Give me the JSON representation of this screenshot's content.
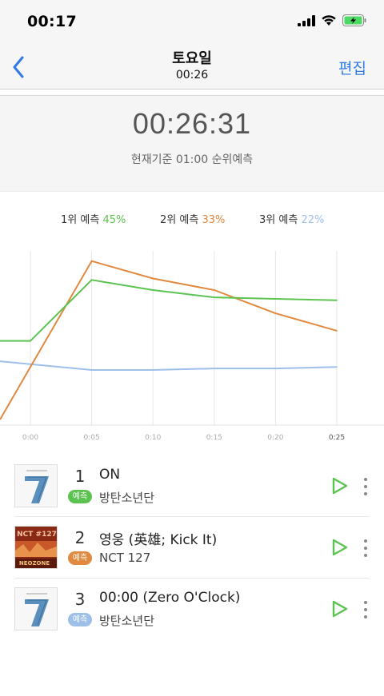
{
  "status": {
    "time": "00:17"
  },
  "nav": {
    "title": "토요일",
    "subtitle": "00:26",
    "edit_label": "편집"
  },
  "timer": {
    "current": "00:26:31",
    "basis": "현재기준 01:00 순위예측"
  },
  "legend": [
    {
      "label": "1위 예측",
      "percent": "45%",
      "color": "#5cc350"
    },
    {
      "label": "2위 예측",
      "percent": "33%",
      "color": "#e0893f"
    },
    {
      "label": "3위 예측",
      "percent": "22%",
      "color": "#9dbfe8"
    }
  ],
  "colors": {
    "accent": "#2f7ae5",
    "green": "#5cc350",
    "orange": "#e0893f",
    "blue": "#9dbfe8"
  },
  "chart_data": {
    "type": "line",
    "x": [
      "0:00",
      "0:05",
      "0:10",
      "0:15",
      "0:20",
      "0:25"
    ],
    "series": [
      {
        "name": "1위 예측",
        "color": "#5cc350",
        "values": [
          58,
          100,
          93,
          88,
          87,
          86
        ]
      },
      {
        "name": "2위 예측",
        "color": "#e0893f",
        "values": [
          40,
          113,
          101,
          93,
          77,
          65
        ]
      },
      {
        "name": "3위 예측",
        "color": "#9dbfe8",
        "values": [
          42,
          38,
          38,
          39,
          39,
          40
        ]
      }
    ],
    "grid": true
  },
  "songs": [
    {
      "rank": "1",
      "title": "ON",
      "badge": "예측",
      "badge_color": "#5cc350",
      "artist": "방탄소년단",
      "album_icon": "album-7-cover"
    },
    {
      "rank": "2",
      "title": "영웅 (英雄; Kick It)",
      "badge": "예측",
      "badge_color": "#e0893f",
      "artist": "NCT 127",
      "album_icon": "album-nct127-cover",
      "album_text": "NCT #127",
      "album_sub": "NEOZONE"
    },
    {
      "rank": "3",
      "title": "00:00 (Zero O'Clock)",
      "badge": "예측",
      "badge_color": "#9dbfe8",
      "artist": "방탄소년단",
      "album_icon": "album-7-cover"
    }
  ]
}
